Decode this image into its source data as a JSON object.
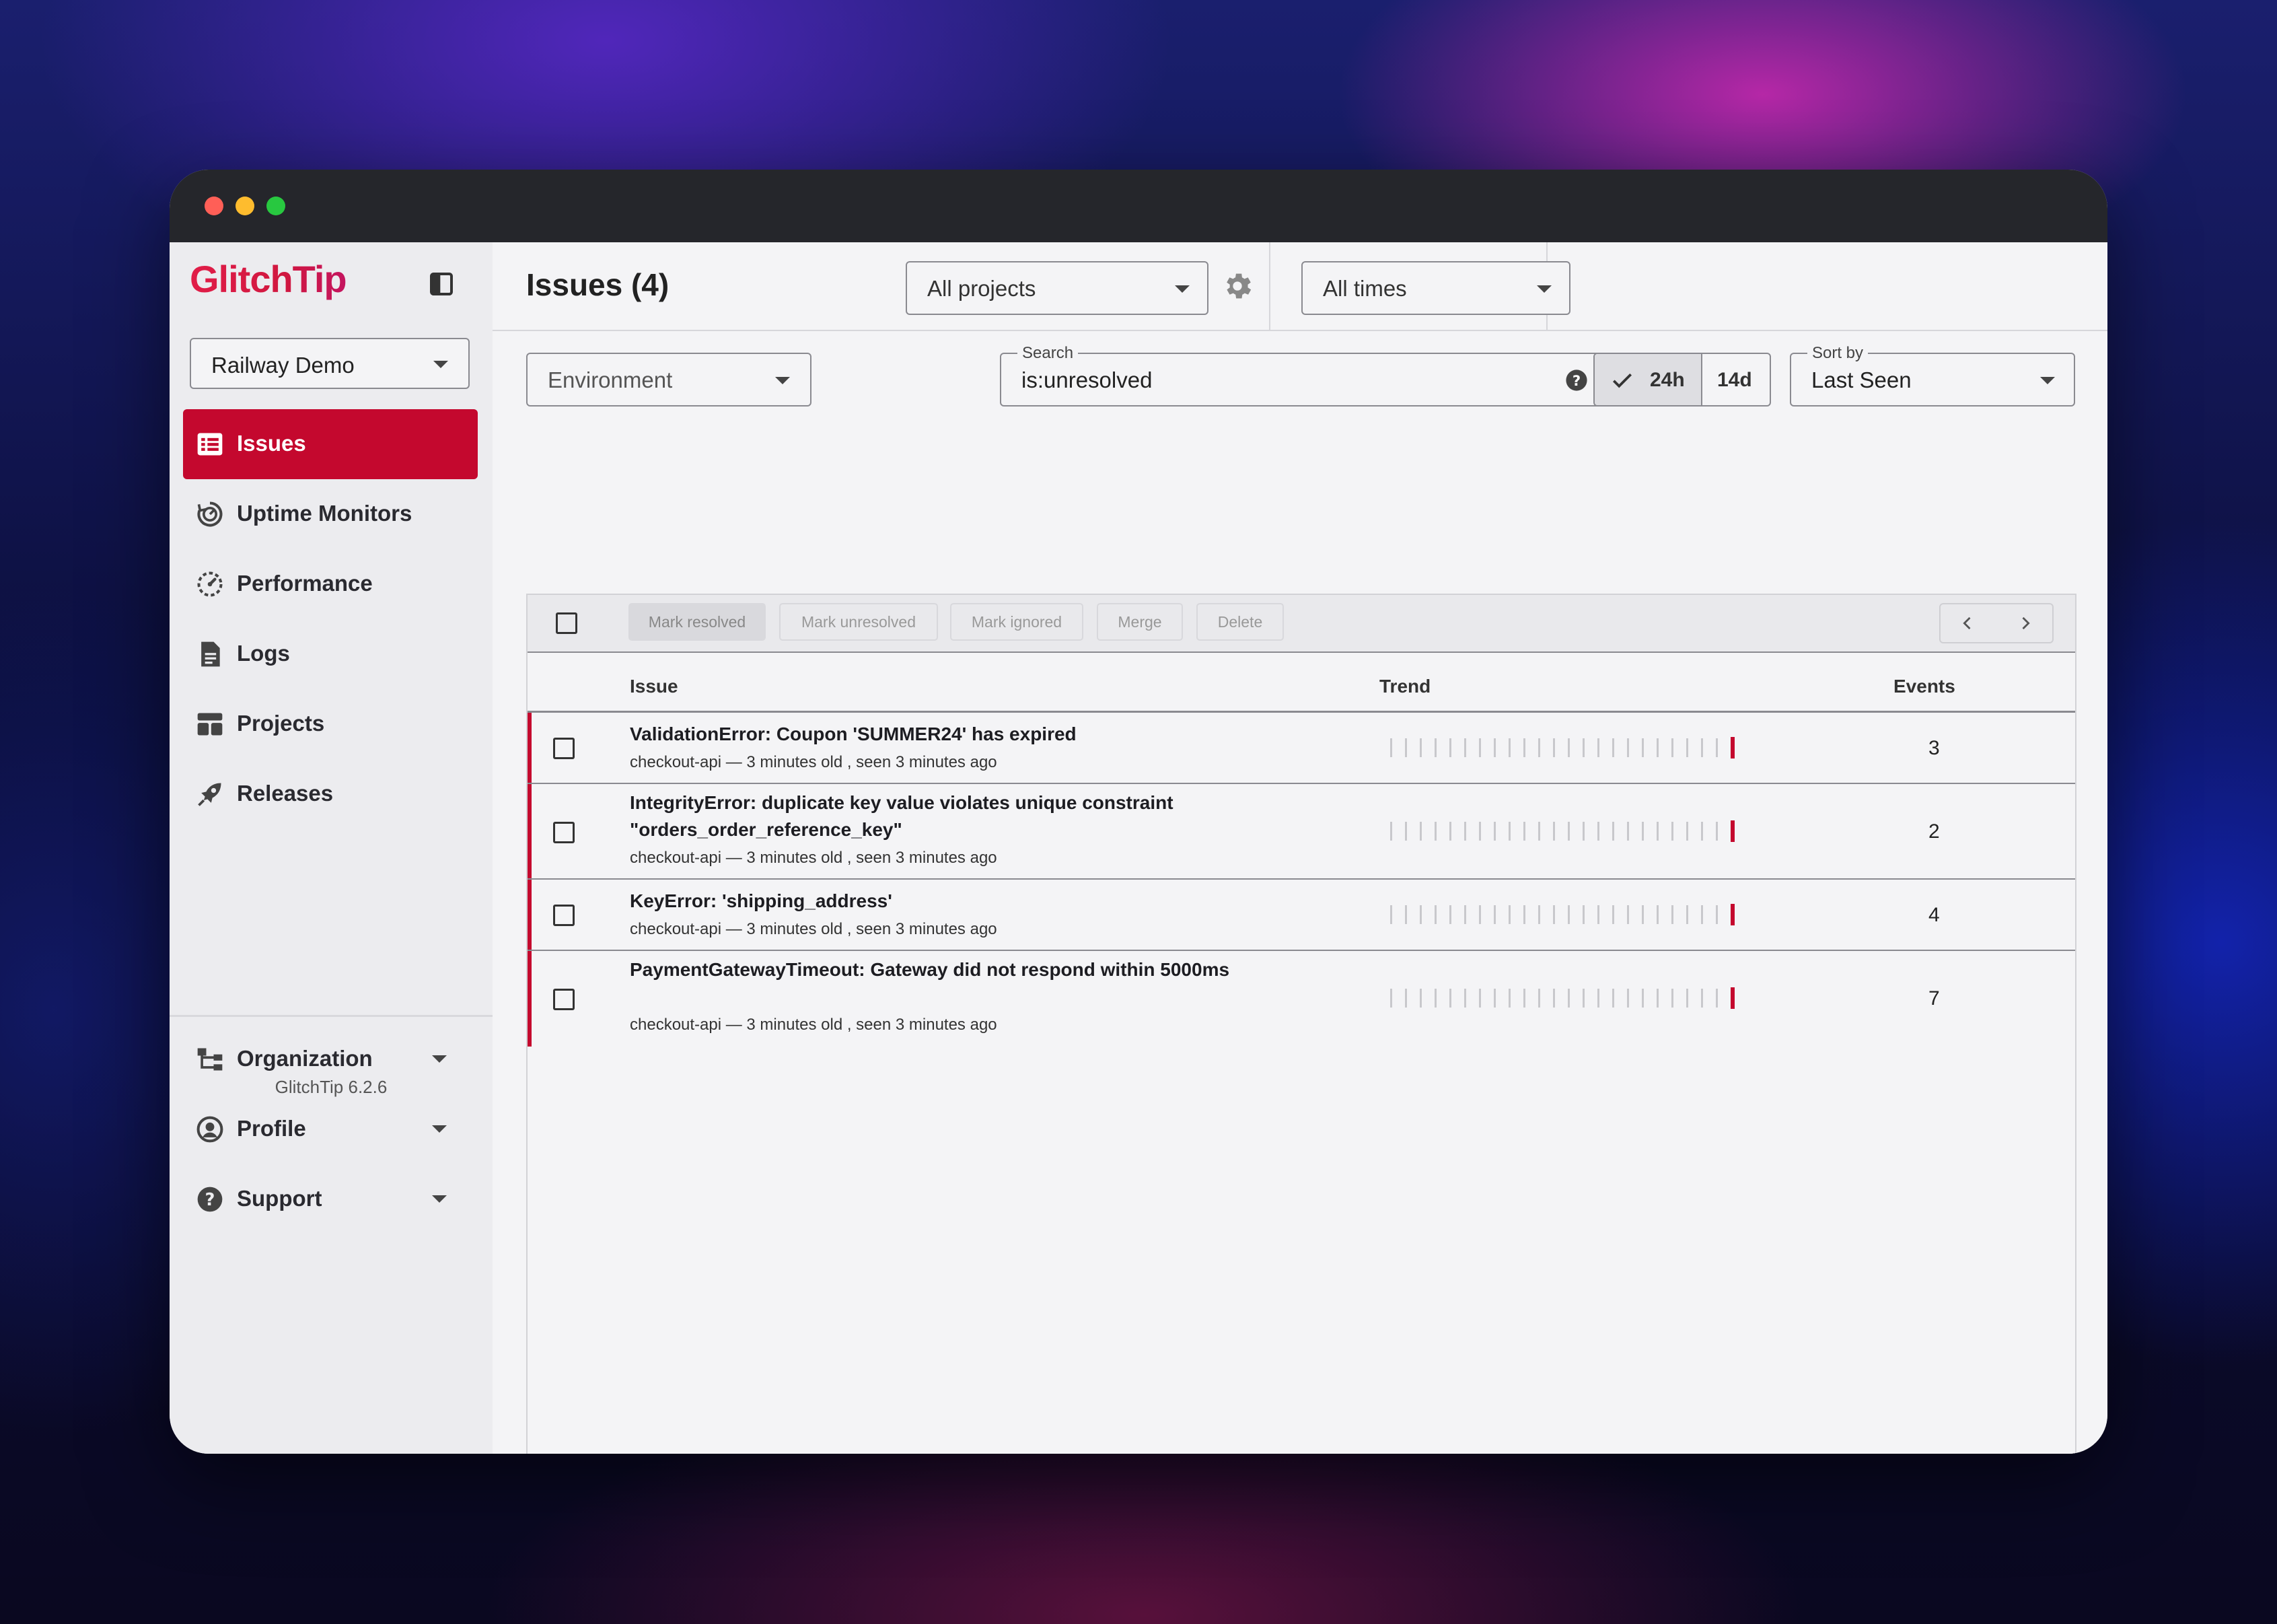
{
  "app": {
    "logo_text": "GlitchTip",
    "version": "GlitchTip 6.2.6",
    "accent_color": "#c4082e"
  },
  "sidebar": {
    "org_select": "Railway Demo",
    "items": [
      {
        "label": "Issues",
        "icon": "issues-icon",
        "active": true
      },
      {
        "label": "Uptime Monitors",
        "icon": "uptime-icon",
        "active": false
      },
      {
        "label": "Performance",
        "icon": "performance-icon",
        "active": false
      },
      {
        "label": "Logs",
        "icon": "logs-icon",
        "active": false
      },
      {
        "label": "Projects",
        "icon": "projects-icon",
        "active": false
      },
      {
        "label": "Releases",
        "icon": "releases-icon",
        "active": false
      }
    ],
    "groups": [
      {
        "label": "Organization",
        "icon": "organization-icon"
      },
      {
        "label": "Profile",
        "icon": "profile-icon"
      },
      {
        "label": "Support",
        "icon": "support-icon"
      }
    ]
  },
  "header": {
    "title": "Issues (4)",
    "project_select": "All projects",
    "time_select": "All times"
  },
  "filters": {
    "environment_placeholder": "Environment",
    "search_label": "Search",
    "search_value": "is:unresolved",
    "range_options": [
      "24h",
      "14d"
    ],
    "range_selected": "24h",
    "sort_label": "Sort by",
    "sort_value": "Last Seen"
  },
  "toolbar": {
    "mark_resolved": "Mark resolved",
    "mark_unresolved": "Mark unresolved",
    "mark_ignored": "Mark ignored",
    "merge": "Merge",
    "delete": "Delete"
  },
  "table": {
    "columns": [
      "Issue",
      "Trend",
      "Events"
    ],
    "rows": [
      {
        "title": "ValidationError: Coupon 'SUMMER24' has expired",
        "meta": "checkout-api — 3 minutes old , seen 3 minutes ago",
        "events": "3"
      },
      {
        "title": "IntegrityError: duplicate key value violates unique constraint \"orders_order_reference_key\"",
        "meta": "checkout-api — 3 minutes old , seen 3 minutes ago",
        "events": "2"
      },
      {
        "title": "KeyError: 'shipping_address'",
        "meta": "checkout-api — 3 minutes old , seen 3 minutes ago",
        "events": "4"
      },
      {
        "title": "PaymentGatewayTimeout: Gateway did not respond within 5000ms",
        "meta": "checkout-api — 3 minutes old , seen 3 minutes ago",
        "events": "7"
      }
    ]
  }
}
